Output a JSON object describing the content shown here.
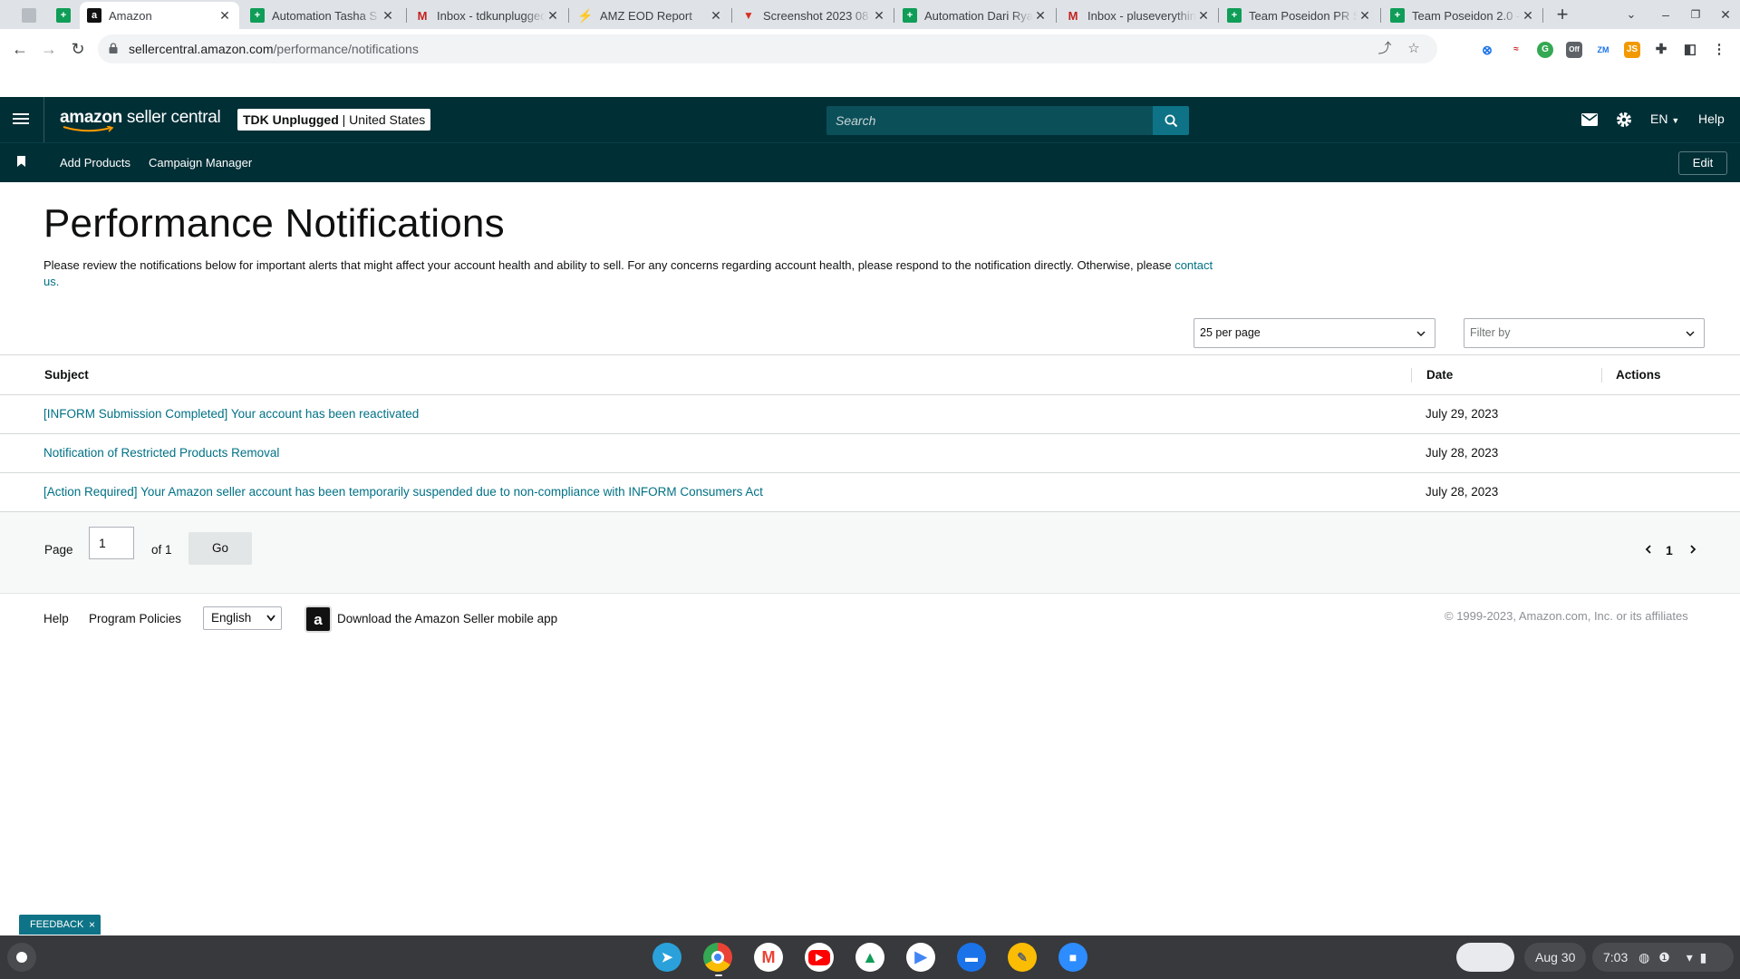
{
  "browser": {
    "tabs": [
      {
        "title": "",
        "favicon": "sheets-icon",
        "pinned": true
      },
      {
        "title": "",
        "favicon": "sheets-icon",
        "pinned": true
      },
      {
        "title": "Amazon",
        "favicon": "amazon-icon",
        "active": true
      },
      {
        "title": "Automation Tasha S",
        "favicon": "sheets-icon"
      },
      {
        "title": "Inbox - tdkunplugged",
        "favicon": "gmail-icon"
      },
      {
        "title": "AMZ EOD Report",
        "favicon": "amz-eod-icon"
      },
      {
        "title": "Screenshot 2023 08",
        "favicon": "screenshot-icon"
      },
      {
        "title": "Automation Dari Rya",
        "favicon": "sheets-icon"
      },
      {
        "title": "Inbox - pluseverythin",
        "favicon": "gmail-icon"
      },
      {
        "title": "Team Poseidon PR S",
        "favicon": "sheets-icon"
      },
      {
        "title": "Team Poseidon 2.0 -",
        "favicon": "sheets-icon"
      }
    ],
    "url_host": "sellercentral.amazon.com",
    "url_path": "/performance/notifications"
  },
  "header": {
    "brand_prefix": "amazon",
    "brand_suffix": " seller central",
    "account_name": "TDK Unplugged",
    "account_region": " | United States",
    "search_placeholder": "Search",
    "language": "EN",
    "help_label": "Help"
  },
  "subnav": {
    "items": [
      "Add Products",
      "Campaign Manager"
    ],
    "edit_label": "Edit"
  },
  "page": {
    "title": "Performance Notifications",
    "intro_text": "Please review the notifications below for important alerts that might affect your account health and ability to sell. For any concerns regarding account health, please respond to the notification directly. Otherwise, please ",
    "intro_link": "contact us.",
    "per_page": "25 per page",
    "filter_placeholder": "Filter by"
  },
  "table": {
    "columns": [
      "Subject",
      "Date",
      "Actions"
    ],
    "rows": [
      {
        "subject": "[INFORM Submission Completed] Your account has been reactivated",
        "date": "July 29, 2023"
      },
      {
        "subject": "Notification of Restricted Products Removal",
        "date": "July 28, 2023"
      },
      {
        "subject": "[Action Required] Your Amazon seller account has been temporarily suspended due to non-compliance with INFORM Consumers Act",
        "date": "July 28, 2023"
      }
    ]
  },
  "pagination": {
    "page_label": "Page",
    "page_value": "1",
    "of_label": "of 1",
    "go_label": "Go",
    "current_page": "1"
  },
  "footer": {
    "help": "Help",
    "program_policies": "Program Policies",
    "language": "English",
    "app_icon_glyph": "a",
    "download_app": "Download the Amazon Seller mobile app",
    "copyright": "© 1999-2023, Amazon.com, Inc. or its affiliates"
  },
  "feedback": {
    "label": "FEEDBACK",
    "close": "×"
  },
  "shelf": {
    "apps": [
      "telegram-icon",
      "chrome-icon",
      "gmail-icon",
      "youtube-icon",
      "drive-icon",
      "play-store-icon",
      "files-icon",
      "keep-icon",
      "zoom-icon"
    ],
    "date": "Aug 30",
    "time": "7:03"
  },
  "colors": {
    "header_bg": "#002f36",
    "link": "#007185",
    "search_button": "#0e7386"
  }
}
